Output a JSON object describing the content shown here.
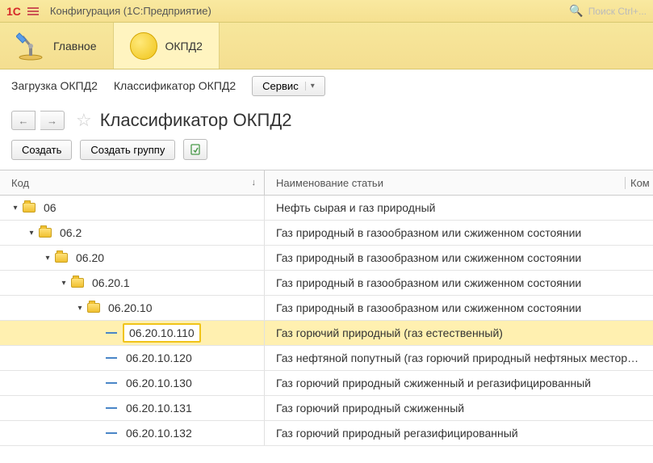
{
  "titlebar": {
    "app_title": "Конфигурация (1С:Предприятие)",
    "search_placeholder": "Поиск Ctrl+..."
  },
  "main_tabs": {
    "home": "Главное",
    "okpd2": "ОКПД2"
  },
  "cmdbar": {
    "load": "Загрузка ОКПД2",
    "classifier": "Классификатор ОКПД2",
    "service": "Сервис"
  },
  "page": {
    "title": "Классификатор ОКПД2"
  },
  "toolbar": {
    "create": "Создать",
    "create_group": "Создать группу"
  },
  "table": {
    "headers": {
      "code": "Код",
      "name": "Наименование статьи",
      "extra": "Ком"
    },
    "rows": [
      {
        "code": "06",
        "name": "Нефть сырая и газ природный",
        "type": "folder",
        "level": 0,
        "expanded": true,
        "selected": false
      },
      {
        "code": "06.2",
        "name": "Газ природный в газообразном или сжиженном состоянии",
        "type": "folder",
        "level": 1,
        "expanded": true,
        "selected": false
      },
      {
        "code": "06.20",
        "name": "Газ природный в газообразном или сжиженном состоянии",
        "type": "folder",
        "level": 2,
        "expanded": true,
        "selected": false
      },
      {
        "code": "06.20.1",
        "name": "Газ природный в газообразном или сжиженном состоянии",
        "type": "folder",
        "level": 3,
        "expanded": true,
        "selected": false
      },
      {
        "code": "06.20.10",
        "name": "Газ природный в газообразном или сжиженном состоянии",
        "type": "folder",
        "level": 4,
        "expanded": true,
        "selected": false
      },
      {
        "code": "06.20.10.110",
        "name": "Газ горючий природный (газ естественный)",
        "type": "item",
        "level": 5,
        "expanded": false,
        "selected": true
      },
      {
        "code": "06.20.10.120",
        "name": "Газ нефтяной попутный (газ горючий природный нефтяных месторожд…",
        "type": "item",
        "level": 5,
        "expanded": false,
        "selected": false
      },
      {
        "code": "06.20.10.130",
        "name": "Газ горючий природный сжиженный и регазифицированный",
        "type": "item",
        "level": 5,
        "expanded": false,
        "selected": false
      },
      {
        "code": "06.20.10.131",
        "name": "Газ горючий природный сжиженный",
        "type": "item",
        "level": 5,
        "expanded": false,
        "selected": false
      },
      {
        "code": "06.20.10.132",
        "name": "Газ горючий природный регазифицированный",
        "type": "item",
        "level": 5,
        "expanded": false,
        "selected": false
      }
    ]
  }
}
